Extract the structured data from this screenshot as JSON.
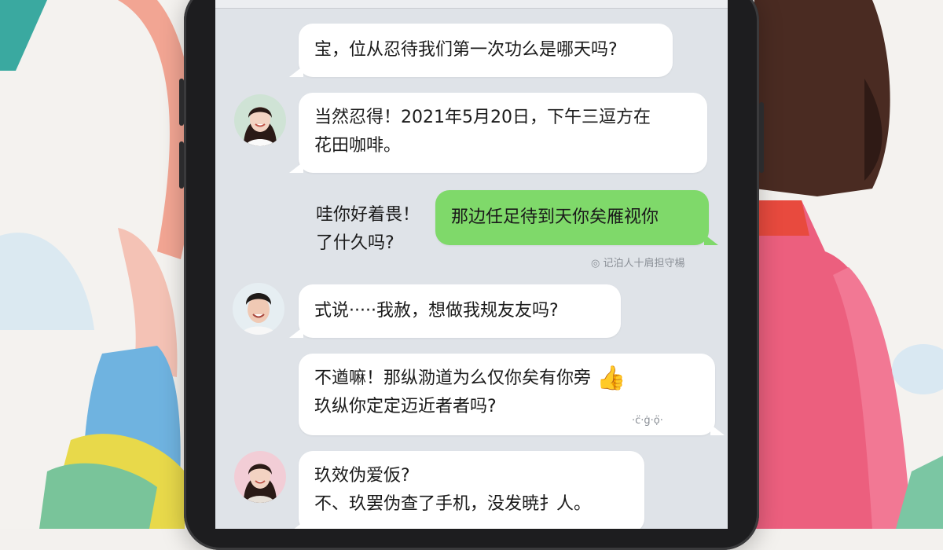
{
  "messages": [
    {
      "id": "m1",
      "text": "宝，位从忍待我们第一次功么是哪天吗?"
    },
    {
      "id": "m2",
      "lines": [
        "当然忍得！2021年5月20日，下午三逗方在",
        "花田咖啡。"
      ]
    },
    {
      "id": "m3",
      "side_lines": [
        "哇你好着畏！",
        "了什久吗?"
      ],
      "green_text": "那边任足待到天你矣雁视你",
      "meta": "◎ 记泊人十肩担守楊"
    },
    {
      "id": "m4",
      "text": "式说·····我赦，想做我规友友吗?"
    },
    {
      "id": "m5",
      "lines": [
        "不遒嘛！那纵泐道为么仅你矣有你旁",
        "玖纵你定定迈近者者吗?"
      ],
      "emoji": "👍",
      "meta": "·c̈·ġ·ọ̈·"
    },
    {
      "id": "m6",
      "lines": [
        "玖效伪爱仮?",
        "不、玖罢伪查了手机，没发暁扌人。"
      ]
    }
  ],
  "icons": {
    "thumbs": "thumbs-up-icon"
  },
  "colors": {
    "screen_bg": "#dfe3e8",
    "sent_bubble": "#7fd96a",
    "received_bubble": "#ffffff"
  }
}
